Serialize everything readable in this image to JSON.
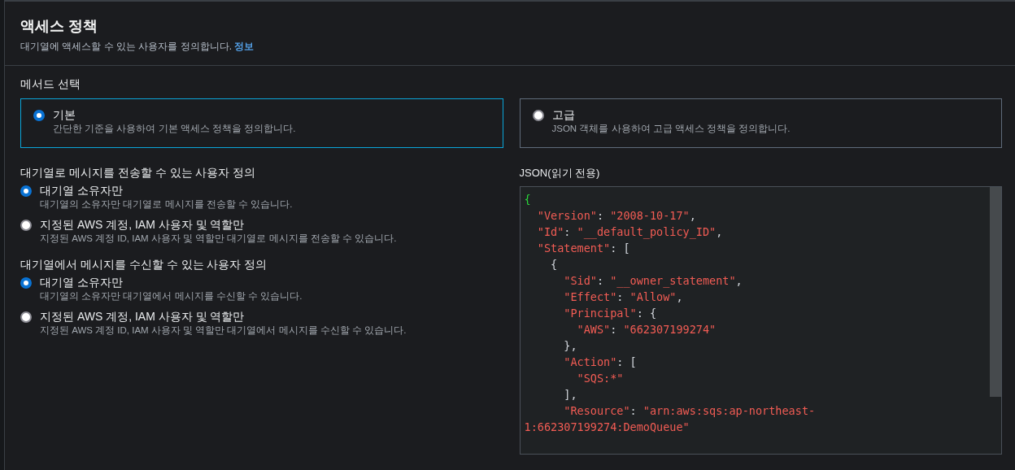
{
  "header": {
    "title": "액세스 정책",
    "description": "대기열에 액세스할 수 있는 사용자를 정의합니다.",
    "info_link": "정보"
  },
  "method": {
    "label": "메서드 선택",
    "options": [
      {
        "title": "기본",
        "description": "간단한 기준을 사용하여 기본 액세스 정책을 정의합니다.",
        "selected": true
      },
      {
        "title": "고급",
        "description": "JSON 객체를 사용하여 고급 액세스 정책을 정의합니다.",
        "selected": false
      }
    ]
  },
  "permission_groups": [
    {
      "label": "대기열로 메시지를 전송할 수 있는 사용자 정의",
      "options": [
        {
          "title": "대기열 소유자만",
          "description": "대기열의 소유자만 대기열로 메시지를 전송할 수 있습니다.",
          "selected": true
        },
        {
          "title": "지정된 AWS 계정, IAM 사용자 및 역할만",
          "description": "지정된 AWS 계정 ID, IAM 사용자 및 역할만 대기열로 메시지를 전송할 수 있습니다.",
          "selected": false
        }
      ]
    },
    {
      "label": "대기열에서 메시지를 수신할 수 있는 사용자 정의",
      "options": [
        {
          "title": "대기열 소유자만",
          "description": "대기열의 소유자만 대기열에서 메시지를 수신할 수 있습니다.",
          "selected": true
        },
        {
          "title": "지정된 AWS 계정, IAM 사용자 및 역할만",
          "description": "지정된 AWS 계정 ID, IAM 사용자 및 역할만 대기열에서 메시지를 수신할 수 있습니다.",
          "selected": false
        }
      ]
    }
  ],
  "json_viewer": {
    "label": "JSON(읽기 전용)",
    "lines": [
      [
        {
          "kind": "root",
          "text": "{"
        }
      ],
      [
        {
          "kind": "string",
          "text": "  \"Version\""
        },
        {
          "kind": "punct",
          "text": ": "
        },
        {
          "kind": "string",
          "text": "\"2008-10-17\""
        },
        {
          "kind": "punct",
          "text": ","
        }
      ],
      [
        {
          "kind": "string",
          "text": "  \"Id\""
        },
        {
          "kind": "punct",
          "text": ": "
        },
        {
          "kind": "string",
          "text": "\"__default_policy_ID\""
        },
        {
          "kind": "punct",
          "text": ","
        }
      ],
      [
        {
          "kind": "string",
          "text": "  \"Statement\""
        },
        {
          "kind": "punct",
          "text": ": ["
        }
      ],
      [
        {
          "kind": "punct",
          "text": "    {"
        }
      ],
      [
        {
          "kind": "string",
          "text": "      \"Sid\""
        },
        {
          "kind": "punct",
          "text": ": "
        },
        {
          "kind": "string",
          "text": "\"__owner_statement\""
        },
        {
          "kind": "punct",
          "text": ","
        }
      ],
      [
        {
          "kind": "string",
          "text": "      \"Effect\""
        },
        {
          "kind": "punct",
          "text": ": "
        },
        {
          "kind": "string",
          "text": "\"Allow\""
        },
        {
          "kind": "punct",
          "text": ","
        }
      ],
      [
        {
          "kind": "string",
          "text": "      \"Principal\""
        },
        {
          "kind": "punct",
          "text": ": {"
        }
      ],
      [
        {
          "kind": "string",
          "text": "        \"AWS\""
        },
        {
          "kind": "punct",
          "text": ": "
        },
        {
          "kind": "string",
          "text": "\"662307199274\""
        }
      ],
      [
        {
          "kind": "punct",
          "text": "      },"
        }
      ],
      [
        {
          "kind": "string",
          "text": "      \"Action\""
        },
        {
          "kind": "punct",
          "text": ": ["
        }
      ],
      [
        {
          "kind": "string",
          "text": "        \"SQS:*\""
        }
      ],
      [
        {
          "kind": "punct",
          "text": "      ],"
        }
      ],
      [
        {
          "kind": "string",
          "text": "      \"Resource\""
        },
        {
          "kind": "punct",
          "text": ": "
        },
        {
          "kind": "string",
          "text": "\"arn:aws:sqs:ap-northeast-"
        }
      ],
      [
        {
          "kind": "string",
          "text": "1:662307199274:DemoQueue\""
        }
      ]
    ]
  }
}
